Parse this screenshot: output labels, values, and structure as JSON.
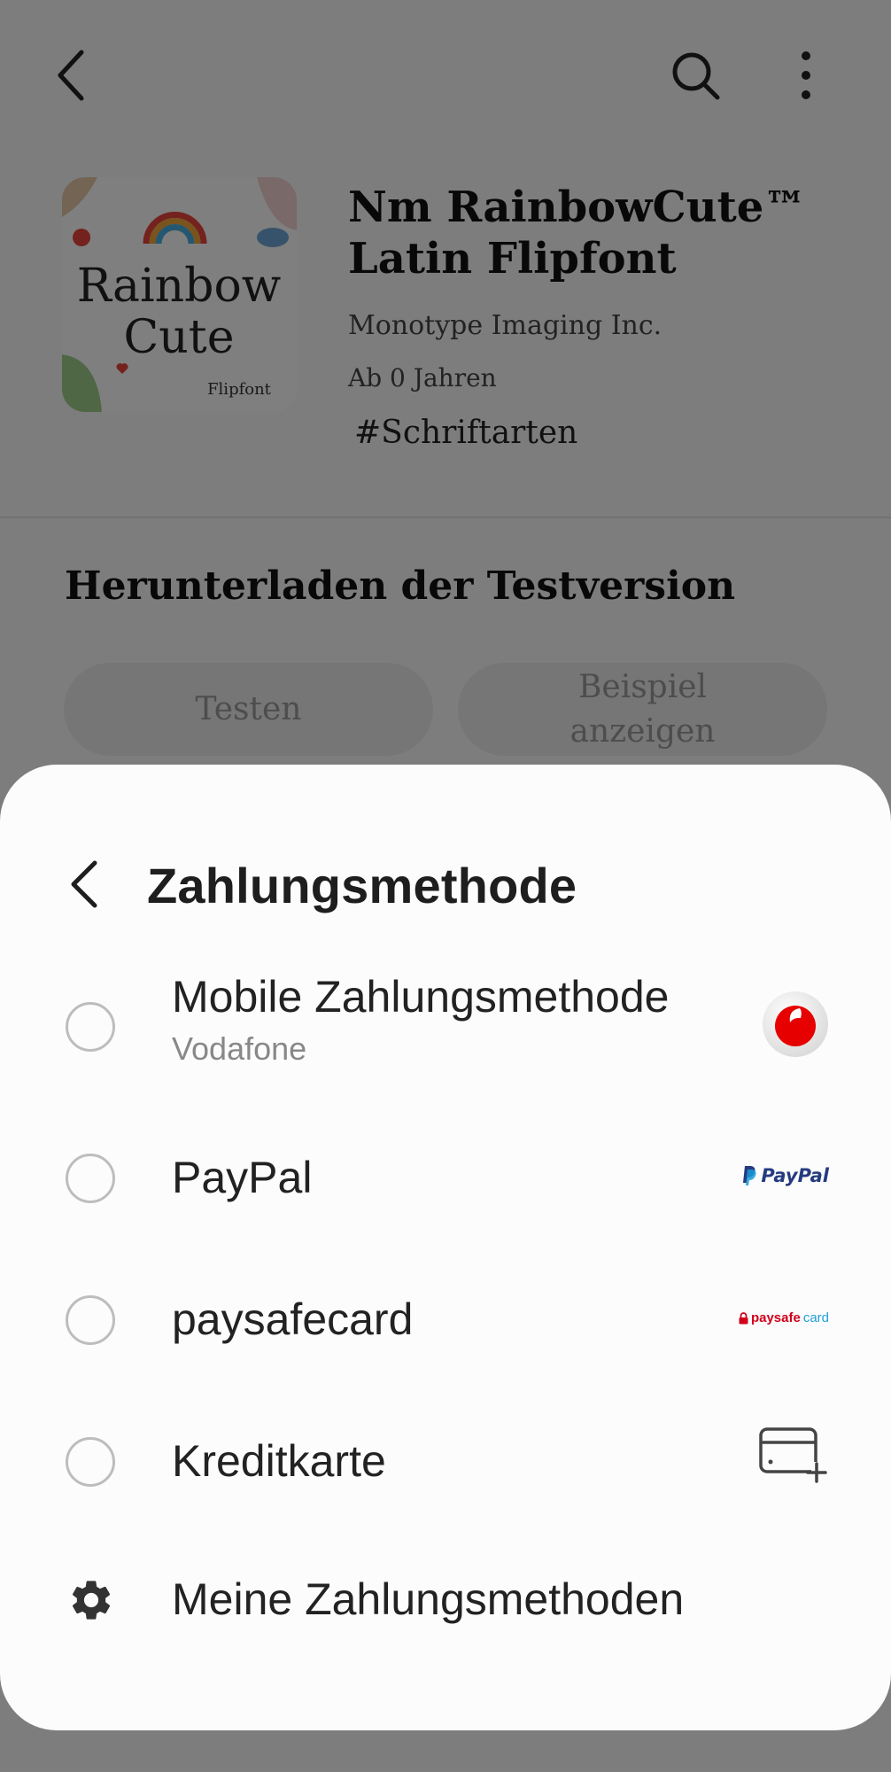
{
  "app": {
    "title_line1": "Nm RainbowCute™",
    "title_line2": "Latin Flipfont",
    "developer": "Monotype Imaging Inc.",
    "age_rating": "Ab 0 Jahren",
    "category": "#Schriftarten",
    "icon_text_1": "Rainbow",
    "icon_text_2": "Cute",
    "icon_text_3": "Flipfont"
  },
  "trial": {
    "section_title": "Herunterladen der Testversion",
    "test_button": "Testen",
    "sample_button_line1": "Beispiel",
    "sample_button_line2": "anzeigen"
  },
  "sheet": {
    "title": "Zahlungsmethode",
    "options": [
      {
        "label": "Mobile Zahlungsmethode",
        "sublabel": "Vodafone",
        "logo": "vodafone-logo",
        "selected": false
      },
      {
        "label": "PayPal",
        "logo_text": "PayPal",
        "logo": "paypal-logo",
        "selected": false
      },
      {
        "label": "paysafecard",
        "logo_text_1": "paysafe",
        "logo_text_2": "card",
        "logo": "paysafecard-logo",
        "selected": false
      },
      {
        "label": "Kreditkarte",
        "logo": "add-credit-card-icon",
        "selected": false
      }
    ],
    "manage_label": "Meine Zahlungsmethoden"
  }
}
